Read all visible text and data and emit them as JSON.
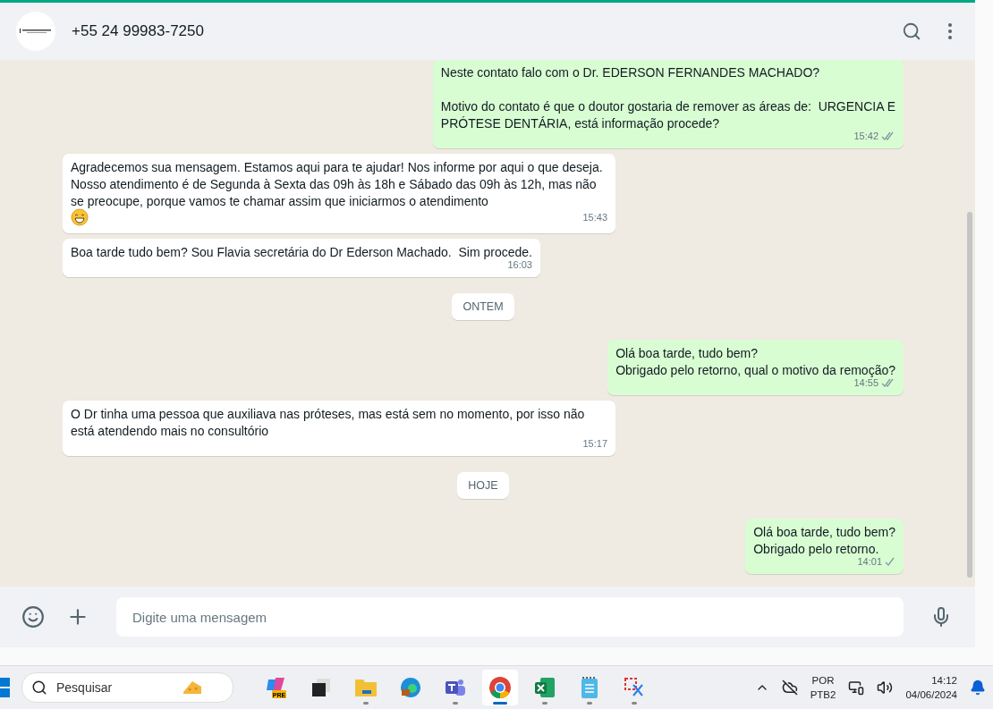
{
  "header": {
    "contact": "+55 24 99983-7250"
  },
  "messages": [
    {
      "kind": "out",
      "text": "Neste contato falo com o Dr. EDERSON FERNANDES MACHADO?\n\nMotivo do contato é que o doutor gostaria de remover as áreas de:  URGENCIA E\nPRÓTESE DENTÁRIA, está informação procede?",
      "time": "15:42",
      "delivered": true
    },
    {
      "kind": "in",
      "text": "Agradecemos sua mensagem. Estamos aqui para te ajudar! Nos informe por aqui o que deseja. Nosso atendimento é de Segunda à Sexta das 09h às 18h e Sábado das 09h às 12h, mas não se preocupe, porque vamos te chamar assim que iniciarmos o atendimento",
      "emoji": true,
      "time": "15:43"
    },
    {
      "kind": "in",
      "text": "Boa tarde tudo bem? Sou Flavia secretária do Dr Ederson Machado.  Sim procede.",
      "time": "16:03"
    },
    {
      "kind": "date",
      "text": "ONTEM"
    },
    {
      "kind": "out",
      "text": "Olá boa tarde, tudo bem?\nObrigado pelo retorno, qual o motivo da remoção?",
      "time": "14:55",
      "delivered": true
    },
    {
      "kind": "in",
      "text": "O Dr tinha uma pessoa que auxiliava nas próteses, mas está sem no momento, por isso não está atendendo mais no consultório",
      "time": "15:17"
    },
    {
      "kind": "date",
      "text": "HOJE"
    },
    {
      "kind": "out",
      "text": "Olá boa tarde, tudo bem?\nObrigado pelo retorno.",
      "time": "14:01",
      "delivered": false
    }
  ],
  "composer": {
    "placeholder": "Digite uma mensagem"
  },
  "taskbar": {
    "search_placeholder": "Pesquisar",
    "apps": [
      {
        "kind": "copilot",
        "badge": "PRE",
        "running": false,
        "selected": false
      },
      {
        "kind": "windows",
        "running": false,
        "selected": false
      },
      {
        "kind": "folder",
        "running": true,
        "selected": false
      },
      {
        "kind": "edge",
        "running": false,
        "selected": false
      },
      {
        "kind": "teams",
        "running": true,
        "selected": false
      },
      {
        "kind": "chrome",
        "running": true,
        "selected": true
      },
      {
        "kind": "excel",
        "running": true,
        "selected": false
      },
      {
        "kind": "notepad",
        "running": true,
        "selected": false
      },
      {
        "kind": "snip",
        "running": true,
        "selected": false
      }
    ],
    "lang": "POR",
    "layout": "PTB2",
    "time": "14:12",
    "date": "04/06/2024"
  }
}
